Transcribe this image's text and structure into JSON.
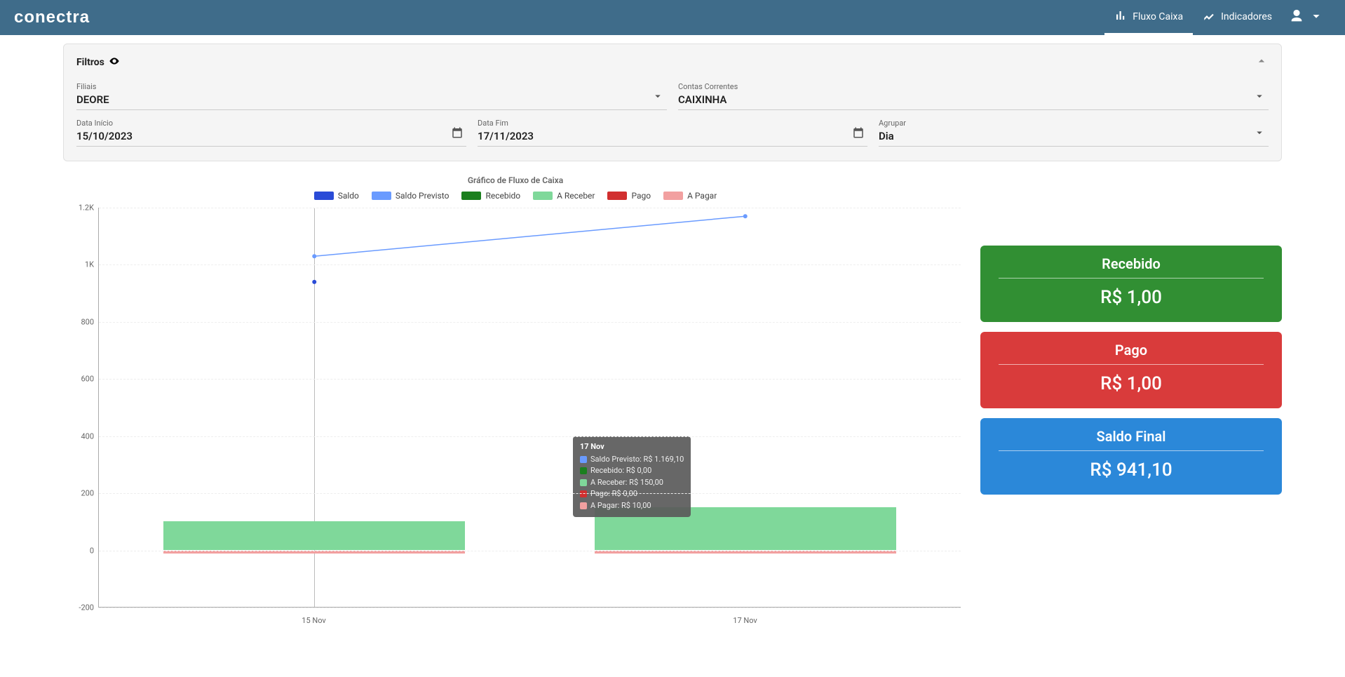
{
  "brand": "conectra",
  "nav": {
    "fluxo": "Fluxo Caixa",
    "indic": "Indicadores"
  },
  "filters": {
    "title": "Filtros",
    "filiais_label": "Filiais",
    "filiais_value": "DEORE",
    "contas_label": "Contas Correntes",
    "contas_value": "CAIXINHA",
    "inicio_label": "Data Início",
    "inicio_value": "15/10/2023",
    "fim_label": "Data Fim",
    "fim_value": "17/11/2023",
    "agrupar_label": "Agrupar",
    "agrupar_value": "Dia"
  },
  "chart": {
    "title": "Gráfico de Fluxo de Caixa",
    "legend": {
      "saldo": "Saldo",
      "saldo_prev": "Saldo Previsto",
      "recebido": "Recebido",
      "a_receber": "A Receber",
      "pago": "Pago",
      "a_pagar": "A Pagar"
    },
    "colors": {
      "saldo": "#2a4bd7",
      "saldo_prev": "#6a9bff",
      "recebido": "#1b7f1e",
      "a_receber": "#7fd89a",
      "pago": "#d12f2f",
      "a_pagar": "#f2a0a0"
    }
  },
  "chart_data": {
    "type": "bar+line",
    "categories": [
      "15 Nov",
      "17 Nov"
    ],
    "ylim": [
      -200,
      1200
    ],
    "yticks": [
      "-200",
      "0",
      "200",
      "400",
      "600",
      "800",
      "1K",
      "1.2K"
    ],
    "series": [
      {
        "name": "Saldo",
        "type": "line",
        "values": [
          940,
          null
        ]
      },
      {
        "name": "Saldo Previsto",
        "type": "line",
        "values": [
          1030,
          1170
        ]
      },
      {
        "name": "Recebido",
        "type": "bar",
        "values": [
          0,
          0
        ]
      },
      {
        "name": "A Receber",
        "type": "bar",
        "values": [
          100,
          150
        ]
      },
      {
        "name": "Pago",
        "type": "bar",
        "values": [
          0,
          0
        ]
      },
      {
        "name": "A Pagar",
        "type": "bar",
        "values": [
          -10,
          -10
        ]
      }
    ]
  },
  "tooltip": {
    "title": "17 Nov",
    "rows": [
      {
        "color": "#6a9bff",
        "label": "Saldo Previsto: R$ 1.169,10"
      },
      {
        "color": "#1b7f1e",
        "label": "Recebido: R$ 0,00"
      },
      {
        "color": "#7fd89a",
        "label": "A Receber: R$ 150,00"
      },
      {
        "color": "#d12f2f",
        "label": "Pago: R$ 0,00"
      },
      {
        "color": "#f2a0a0",
        "label": "A Pagar: R$ 10,00"
      }
    ]
  },
  "summary": {
    "recebido_label": "Recebido",
    "recebido_value": "R$ 1,00",
    "pago_label": "Pago",
    "pago_value": "R$ 1,00",
    "saldo_label": "Saldo Final",
    "saldo_value": "R$ 941,10"
  }
}
